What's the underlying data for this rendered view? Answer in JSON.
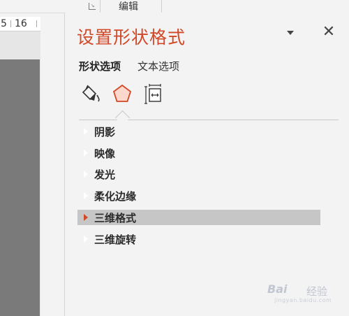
{
  "ribbon": {
    "group_label": "编辑",
    "launcher_icon": "dialog-launcher-icon"
  },
  "ruler": {
    "text_left": "5",
    "text_right": "16"
  },
  "pane": {
    "title": "设置形状格式",
    "title_color": "#d24726",
    "tabs": [
      {
        "label": "形状选项",
        "active": true
      },
      {
        "label": "文本选项",
        "active": false
      }
    ],
    "icons": [
      {
        "name": "fill-line-icon",
        "selected": false
      },
      {
        "name": "effects-pentagon-icon",
        "selected": true
      },
      {
        "name": "size-properties-icon",
        "selected": false
      }
    ],
    "sections": [
      {
        "label": "阴影",
        "selected": false
      },
      {
        "label": "映像",
        "selected": false
      },
      {
        "label": "发光",
        "selected": false
      },
      {
        "label": "柔化边缘",
        "selected": false
      },
      {
        "label": "三维格式",
        "selected": true
      },
      {
        "label": "三维旋转",
        "selected": false
      }
    ]
  },
  "watermark": {
    "brand": "Bai",
    "text": "经验",
    "sub": "jingyan.baidu.com"
  }
}
